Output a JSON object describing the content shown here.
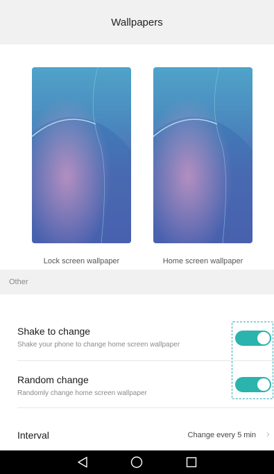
{
  "header": {
    "title": "Wallpapers"
  },
  "wallpapers": {
    "lock_label": "Lock screen wallpaper",
    "home_label": "Home screen wallpaper"
  },
  "section": {
    "title": "Other"
  },
  "settings": {
    "shake": {
      "label": "Shake to change",
      "description": "Shake your phone to change home screen wallpaper",
      "enabled": true
    },
    "random": {
      "label": "Random change",
      "description": "Randomly change home screen wallpaper",
      "enabled": true
    },
    "interval": {
      "label": "Interval",
      "value": "Change every 5 min"
    }
  },
  "navbar": {
    "back_icon": "back-triangle-icon",
    "home_icon": "home-circle-icon",
    "recents_icon": "recents-square-icon"
  },
  "colors": {
    "accent": "#2bb3ad",
    "header_bg": "#f1f1f1",
    "navbar_bg": "#000000"
  }
}
